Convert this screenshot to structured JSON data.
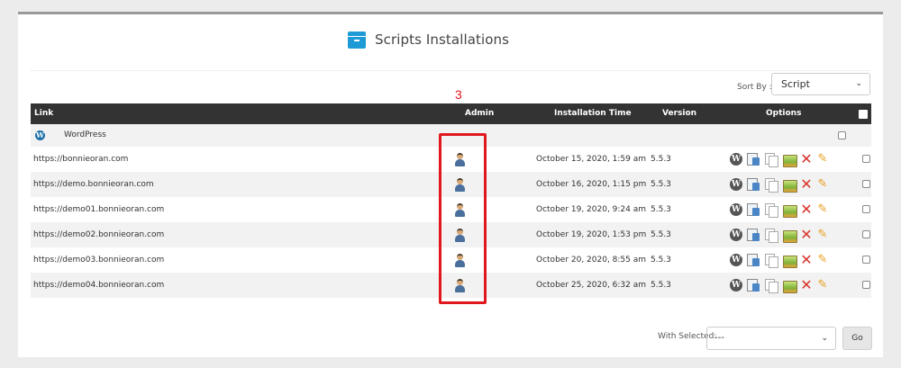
{
  "header": {
    "title": "Scripts Installations",
    "icon": "archive-box-icon",
    "accent": "#1e9bd6"
  },
  "sort": {
    "label": "Sort By :",
    "value": "Script"
  },
  "table": {
    "columns": {
      "link": "Link",
      "admin": "Admin",
      "time": "Installation Time",
      "version": "Version",
      "options": "Options"
    },
    "group": {
      "label": "WordPress",
      "icon": "wordpress-icon"
    },
    "rows": [
      {
        "link": "https://bonnieoran.com",
        "time": "October 15, 2020, 1:59 am",
        "version": "5.5.3"
      },
      {
        "link": "https://demo.bonnieoran.com",
        "time": "October 16, 2020, 1:15 pm",
        "version": "5.5.3"
      },
      {
        "link": "https://demo01.bonnieoran.com",
        "time": "October 19, 2020, 9:24 am",
        "version": "5.5.3"
      },
      {
        "link": "https://demo02.bonnieoran.com",
        "time": "October 19, 2020, 1:53 pm",
        "version": "5.5.3"
      },
      {
        "link": "https://demo03.bonnieoran.com",
        "time": "October 20, 2020, 8:55 am",
        "version": "5.5.3"
      },
      {
        "link": "https://demo04.bonnieoran.com",
        "time": "October 25, 2020, 6:32 am",
        "version": "5.5.3"
      }
    ],
    "option_icons": [
      "wordpress-icon",
      "backup-icon",
      "clone-icon",
      "staging-icon",
      "delete-icon",
      "edit-icon"
    ]
  },
  "annotation": {
    "number": "3",
    "color": "#e0181e"
  },
  "footer": {
    "with_selected_label": "With Selected:",
    "with_selected_value": "---",
    "go_label": "Go"
  }
}
